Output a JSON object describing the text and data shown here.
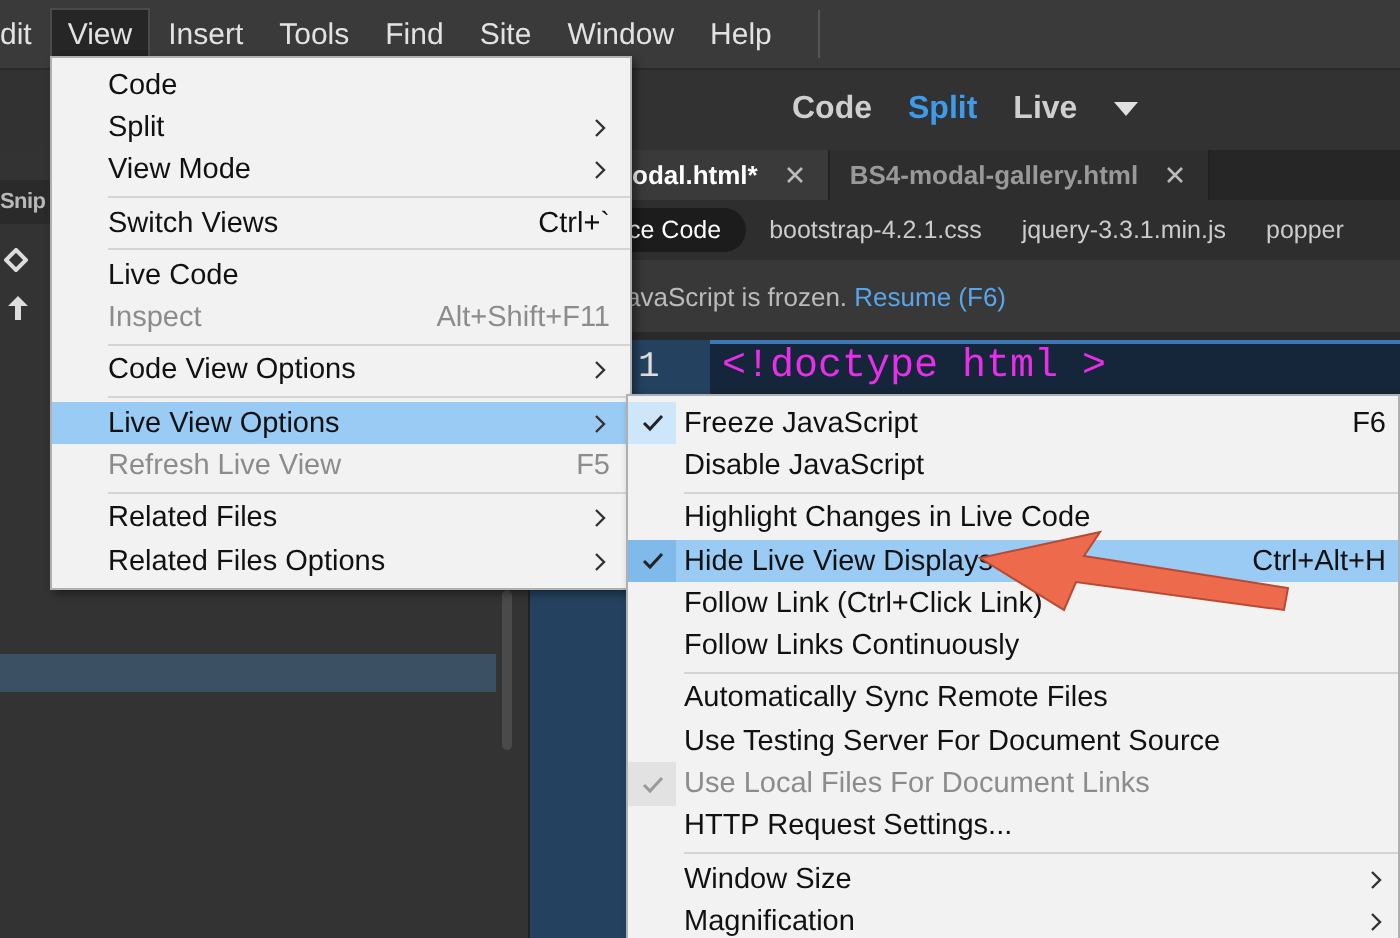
{
  "menubar": {
    "items": [
      {
        "label": "dit",
        "selected": false
      },
      {
        "label": "View",
        "selected": true
      },
      {
        "label": "Insert",
        "selected": false
      },
      {
        "label": "Tools",
        "selected": false
      },
      {
        "label": "Find",
        "selected": false
      },
      {
        "label": "Site",
        "selected": false
      },
      {
        "label": "Window",
        "selected": false
      },
      {
        "label": "Help",
        "selected": false
      }
    ]
  },
  "view_switcher": {
    "items": [
      {
        "label": "Code",
        "selected": false
      },
      {
        "label": "Split",
        "selected": true
      },
      {
        "label": "Live",
        "selected": false
      }
    ]
  },
  "side_panel": {
    "tab": "Snip"
  },
  "document_tabs": [
    {
      "label": "odal.html*",
      "selected": true
    },
    {
      "label": "BS4-modal-gallery.html",
      "selected": false
    }
  ],
  "related_files": [
    {
      "label": "ce Code",
      "selected": true
    },
    {
      "label": "bootstrap-4.2.1.css",
      "selected": false
    },
    {
      "label": "jquery-3.3.1.min.js",
      "selected": false
    },
    {
      "label": "popper",
      "selected": false
    }
  ],
  "info_bar": {
    "message": "avaScript is frozen.",
    "link": "Resume (F6)"
  },
  "code": {
    "line_number": "1",
    "text": "<!doctype html >"
  },
  "view_menu": {
    "items": [
      {
        "kind": "item",
        "label": "Code",
        "submenu": false,
        "disabled": false,
        "selected": false
      },
      {
        "kind": "item",
        "label": "Split",
        "submenu": true,
        "disabled": false,
        "selected": false
      },
      {
        "kind": "item",
        "label": "View Mode",
        "submenu": true,
        "disabled": false,
        "selected": false
      },
      {
        "kind": "separator"
      },
      {
        "kind": "item",
        "label": "Switch Views",
        "shortcut": "Ctrl+`",
        "submenu": false,
        "disabled": false,
        "selected": false
      },
      {
        "kind": "separator"
      },
      {
        "kind": "item",
        "label": "Live Code",
        "submenu": false,
        "disabled": false,
        "selected": false
      },
      {
        "kind": "item",
        "label": "Inspect",
        "shortcut": "Alt+Shift+F11",
        "submenu": false,
        "disabled": true,
        "selected": false
      },
      {
        "kind": "separator"
      },
      {
        "kind": "item",
        "label": "Code View Options",
        "submenu": true,
        "disabled": false,
        "selected": false
      },
      {
        "kind": "separator"
      },
      {
        "kind": "item",
        "label": "Live View Options",
        "submenu": true,
        "disabled": false,
        "selected": true
      },
      {
        "kind": "item",
        "label": "Refresh Live View",
        "shortcut": "F5",
        "submenu": false,
        "disabled": true,
        "selected": false
      },
      {
        "kind": "separator"
      },
      {
        "kind": "item",
        "label": "Related Files",
        "submenu": true,
        "disabled": false,
        "selected": false
      },
      {
        "kind": "item",
        "label": "Related Files Options",
        "submenu": true,
        "disabled": false,
        "selected": false
      }
    ]
  },
  "live_view_menu": {
    "items": [
      {
        "kind": "item",
        "label": "Freeze JavaScript",
        "shortcut": "F6",
        "checked": true,
        "submenu": false,
        "disabled": false,
        "selected": false
      },
      {
        "kind": "item",
        "label": "Disable JavaScript",
        "checked": false,
        "submenu": false,
        "disabled": false,
        "selected": false
      },
      {
        "kind": "separator"
      },
      {
        "kind": "item",
        "label": "Highlight Changes in Live Code",
        "checked": false,
        "submenu": false,
        "disabled": false,
        "selected": false
      },
      {
        "kind": "item",
        "label": "Hide Live View Displays",
        "shortcut": "Ctrl+Alt+H",
        "checked": true,
        "submenu": false,
        "disabled": false,
        "selected": true
      },
      {
        "kind": "item",
        "label": "Follow Link (Ctrl+Click Link)",
        "checked": false,
        "submenu": false,
        "disabled": false,
        "selected": false
      },
      {
        "kind": "item",
        "label": "Follow Links Continuously",
        "checked": false,
        "submenu": false,
        "disabled": false,
        "selected": false
      },
      {
        "kind": "separator"
      },
      {
        "kind": "item",
        "label": "Automatically Sync Remote Files",
        "checked": false,
        "submenu": false,
        "disabled": false,
        "selected": false
      },
      {
        "kind": "item",
        "label": "Use Testing Server For Document Source",
        "checked": false,
        "submenu": false,
        "disabled": false,
        "selected": false
      },
      {
        "kind": "item",
        "label": "Use Local Files For Document Links",
        "checked": true,
        "submenu": false,
        "disabled": true,
        "selected": false
      },
      {
        "kind": "item",
        "label": "HTTP Request Settings...",
        "checked": false,
        "submenu": false,
        "disabled": false,
        "selected": false
      },
      {
        "kind": "separator"
      },
      {
        "kind": "item",
        "label": "Window Size",
        "checked": false,
        "submenu": true,
        "disabled": false,
        "selected": false
      },
      {
        "kind": "item",
        "label": "Magnification",
        "checked": false,
        "submenu": true,
        "disabled": false,
        "selected": false
      }
    ]
  }
}
